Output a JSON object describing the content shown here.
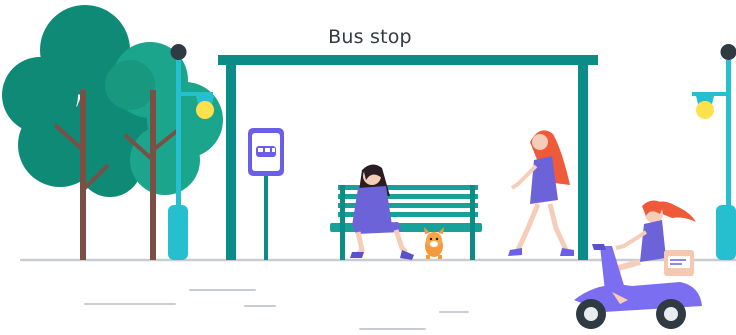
{
  "scene": {
    "title": "Bus stop"
  },
  "colors": {
    "tree_dark": "#0f8a76",
    "tree_mid": "#1ba58c",
    "trunk": "#7b4f44",
    "shelter_teal": "#0c8c87",
    "lamp_cyan": "#26bfd0",
    "lamp_bulb": "#ffe14d",
    "sign_purple": "#6a5fe6",
    "bench_teal": "#17a199",
    "person_purple": "#6d63d8",
    "hair_red": "#ef5a3a",
    "skin": "#f6cdb8",
    "scooter_purple": "#7b6ef0",
    "ground": "#c9cdd2"
  },
  "icons": [
    "tree-icon",
    "street-lamp-icon",
    "bus-sign-icon",
    "bench-icon",
    "dog-icon",
    "scooter-icon"
  ]
}
